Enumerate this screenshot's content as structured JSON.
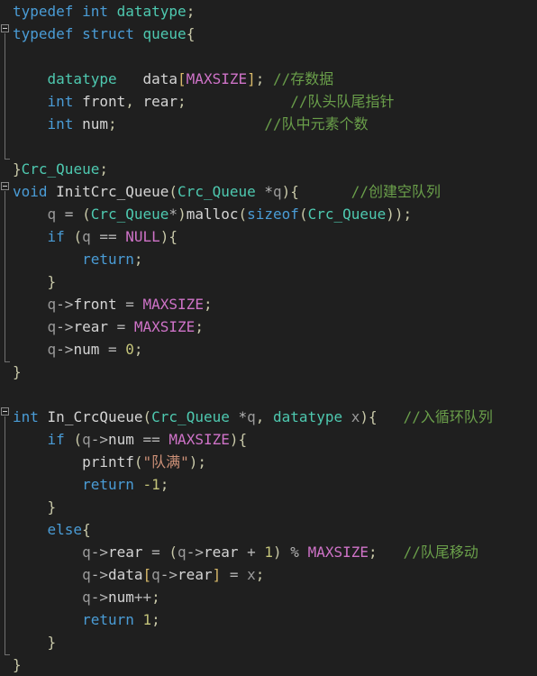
{
  "editor": {
    "name": "code-editor",
    "language": "C",
    "theme": "dark",
    "background_color": "#1f1f1f",
    "colors": {
      "keyword": "#4a9cd6",
      "type": "#4ec9b0",
      "identifier": "#d4d4d4",
      "variable": "#9a9a9a",
      "macro": "#cf73c8",
      "number": "#c4c47a",
      "string": "#ce9178",
      "comment": "#6a9f4a",
      "punctuation": "#c8c8a8",
      "bracket": "#d8b96a"
    },
    "fold_markers": [
      {
        "name": "fold-marker-struct-queue",
        "line": 2,
        "state": "expanded"
      },
      {
        "name": "fold-marker-init-crc-queue",
        "line": 8,
        "state": "expanded"
      },
      {
        "name": "fold-marker-in-crcqueue",
        "line": 18,
        "state": "expanded"
      }
    ]
  },
  "code_lines": [
    {
      "id": 1,
      "tokens": [
        {
          "t": "typedef",
          "c": "kw"
        },
        {
          "t": " ",
          "c": "pun"
        },
        {
          "t": "int",
          "c": "kw"
        },
        {
          "t": " ",
          "c": "pun"
        },
        {
          "t": "datatype",
          "c": "typ"
        },
        {
          "t": ";",
          "c": "pun"
        }
      ]
    },
    {
      "id": 2,
      "tokens": [
        {
          "t": "typedef",
          "c": "kw"
        },
        {
          "t": " ",
          "c": "pun"
        },
        {
          "t": "struct",
          "c": "kw"
        },
        {
          "t": " ",
          "c": "pun"
        },
        {
          "t": "queue",
          "c": "typ"
        },
        {
          "t": "{",
          "c": "pun"
        }
      ]
    },
    {
      "id": 3,
      "tokens": []
    },
    {
      "id": 4,
      "tokens": [
        {
          "t": "    ",
          "c": "pun"
        },
        {
          "t": "datatype",
          "c": "typ"
        },
        {
          "t": "   ",
          "c": "pun"
        },
        {
          "t": "data",
          "c": "fn"
        },
        {
          "t": "[",
          "c": "brk"
        },
        {
          "t": "MAXSIZE",
          "c": "mac"
        },
        {
          "t": "]",
          "c": "brk"
        },
        {
          "t": ";",
          "c": "pun"
        },
        {
          "t": " ",
          "c": "pun"
        },
        {
          "t": "//存数据",
          "c": "cmt"
        }
      ]
    },
    {
      "id": 5,
      "tokens": [
        {
          "t": "    ",
          "c": "pun"
        },
        {
          "t": "int",
          "c": "kw"
        },
        {
          "t": " ",
          "c": "pun"
        },
        {
          "t": "front",
          "c": "fn"
        },
        {
          "t": ", ",
          "c": "pun"
        },
        {
          "t": "rear",
          "c": "fn"
        },
        {
          "t": ";",
          "c": "pun"
        },
        {
          "t": "            ",
          "c": "pun"
        },
        {
          "t": "//队头队尾指针",
          "c": "cmt"
        }
      ]
    },
    {
      "id": 6,
      "tokens": [
        {
          "t": "    ",
          "c": "pun"
        },
        {
          "t": "int",
          "c": "kw"
        },
        {
          "t": " ",
          "c": "pun"
        },
        {
          "t": "num",
          "c": "fn"
        },
        {
          "t": ";",
          "c": "pun"
        },
        {
          "t": "                 ",
          "c": "pun"
        },
        {
          "t": "//队中元素个数",
          "c": "cmt"
        }
      ]
    },
    {
      "id": 7,
      "tokens": []
    },
    {
      "id": 8,
      "tokens": [
        {
          "t": "}",
          "c": "pun"
        },
        {
          "t": "Crc_Queue",
          "c": "typ"
        },
        {
          "t": ";",
          "c": "pun"
        }
      ]
    },
    {
      "id": 9,
      "tokens": [
        {
          "t": "void",
          "c": "kw"
        },
        {
          "t": " ",
          "c": "pun"
        },
        {
          "t": "InitCrc_Queue",
          "c": "fn"
        },
        {
          "t": "(",
          "c": "pun"
        },
        {
          "t": "Crc_Queue",
          "c": "typ"
        },
        {
          "t": " *",
          "c": "op"
        },
        {
          "t": "q",
          "c": "var"
        },
        {
          "t": ")",
          "c": "pun"
        },
        {
          "t": "{",
          "c": "pun"
        },
        {
          "t": "      ",
          "c": "pun"
        },
        {
          "t": "//创建空队列",
          "c": "cmt"
        }
      ]
    },
    {
      "id": 10,
      "tokens": [
        {
          "t": "    ",
          "c": "pun"
        },
        {
          "t": "q",
          "c": "var"
        },
        {
          "t": " = ",
          "c": "op"
        },
        {
          "t": "(",
          "c": "pun"
        },
        {
          "t": "Crc_Queue",
          "c": "typ"
        },
        {
          "t": "*",
          "c": "op"
        },
        {
          "t": ")",
          "c": "pun"
        },
        {
          "t": "malloc",
          "c": "fn"
        },
        {
          "t": "(",
          "c": "pun"
        },
        {
          "t": "sizeof",
          "c": "kw"
        },
        {
          "t": "(",
          "c": "pun"
        },
        {
          "t": "Crc_Queue",
          "c": "typ"
        },
        {
          "t": "))",
          "c": "pun"
        },
        {
          "t": ";",
          "c": "pun"
        }
      ]
    },
    {
      "id": 11,
      "tokens": [
        {
          "t": "    ",
          "c": "pun"
        },
        {
          "t": "if",
          "c": "kw"
        },
        {
          "t": " ",
          "c": "pun"
        },
        {
          "t": "(",
          "c": "pun"
        },
        {
          "t": "q",
          "c": "var"
        },
        {
          "t": " == ",
          "c": "op"
        },
        {
          "t": "NULL",
          "c": "mac"
        },
        {
          "t": ")",
          "c": "pun"
        },
        {
          "t": "{",
          "c": "pun"
        }
      ]
    },
    {
      "id": 12,
      "tokens": [
        {
          "t": "        ",
          "c": "pun"
        },
        {
          "t": "return",
          "c": "kw"
        },
        {
          "t": ";",
          "c": "pun"
        }
      ]
    },
    {
      "id": 13,
      "tokens": [
        {
          "t": "    ",
          "c": "pun"
        },
        {
          "t": "}",
          "c": "pun"
        }
      ]
    },
    {
      "id": 14,
      "tokens": [
        {
          "t": "    ",
          "c": "pun"
        },
        {
          "t": "q",
          "c": "var"
        },
        {
          "t": "->",
          "c": "op"
        },
        {
          "t": "front",
          "c": "fn"
        },
        {
          "t": " = ",
          "c": "op"
        },
        {
          "t": "MAXSIZE",
          "c": "mac"
        },
        {
          "t": ";",
          "c": "pun"
        }
      ]
    },
    {
      "id": 15,
      "tokens": [
        {
          "t": "    ",
          "c": "pun"
        },
        {
          "t": "q",
          "c": "var"
        },
        {
          "t": "->",
          "c": "op"
        },
        {
          "t": "rear",
          "c": "fn"
        },
        {
          "t": " = ",
          "c": "op"
        },
        {
          "t": "MAXSIZE",
          "c": "mac"
        },
        {
          "t": ";",
          "c": "pun"
        }
      ]
    },
    {
      "id": 16,
      "tokens": [
        {
          "t": "    ",
          "c": "pun"
        },
        {
          "t": "q",
          "c": "var"
        },
        {
          "t": "->",
          "c": "op"
        },
        {
          "t": "num",
          "c": "fn"
        },
        {
          "t": " = ",
          "c": "op"
        },
        {
          "t": "0",
          "c": "num"
        },
        {
          "t": ";",
          "c": "pun"
        }
      ]
    },
    {
      "id": 17,
      "tokens": [
        {
          "t": "}",
          "c": "pun"
        }
      ]
    },
    {
      "id": 18,
      "tokens": []
    },
    {
      "id": 19,
      "tokens": [
        {
          "t": "int",
          "c": "kw"
        },
        {
          "t": " ",
          "c": "pun"
        },
        {
          "t": "In_CrcQueue",
          "c": "fn"
        },
        {
          "t": "(",
          "c": "pun"
        },
        {
          "t": "Crc_Queue",
          "c": "typ"
        },
        {
          "t": " *",
          "c": "op"
        },
        {
          "t": "q",
          "c": "var"
        },
        {
          "t": ", ",
          "c": "pun"
        },
        {
          "t": "datatype",
          "c": "typ"
        },
        {
          "t": " ",
          "c": "pun"
        },
        {
          "t": "x",
          "c": "var"
        },
        {
          "t": ")",
          "c": "pun"
        },
        {
          "t": "{",
          "c": "pun"
        },
        {
          "t": "   ",
          "c": "pun"
        },
        {
          "t": "//入循环队列",
          "c": "cmt"
        }
      ]
    },
    {
      "id": 20,
      "tokens": [
        {
          "t": "    ",
          "c": "pun"
        },
        {
          "t": "if",
          "c": "kw"
        },
        {
          "t": " ",
          "c": "pun"
        },
        {
          "t": "(",
          "c": "pun"
        },
        {
          "t": "q",
          "c": "var"
        },
        {
          "t": "->",
          "c": "op"
        },
        {
          "t": "num",
          "c": "fn"
        },
        {
          "t": " == ",
          "c": "op"
        },
        {
          "t": "MAXSIZE",
          "c": "mac"
        },
        {
          "t": ")",
          "c": "pun"
        },
        {
          "t": "{",
          "c": "pun"
        }
      ]
    },
    {
      "id": 21,
      "tokens": [
        {
          "t": "        ",
          "c": "pun"
        },
        {
          "t": "printf",
          "c": "fn"
        },
        {
          "t": "(",
          "c": "pun"
        },
        {
          "t": "\"队满\"",
          "c": "str"
        },
        {
          "t": ")",
          "c": "pun"
        },
        {
          "t": ";",
          "c": "pun"
        }
      ]
    },
    {
      "id": 22,
      "tokens": [
        {
          "t": "        ",
          "c": "pun"
        },
        {
          "t": "return",
          "c": "kw"
        },
        {
          "t": " ",
          "c": "pun"
        },
        {
          "t": "-1",
          "c": "num"
        },
        {
          "t": ";",
          "c": "pun"
        }
      ]
    },
    {
      "id": 23,
      "tokens": [
        {
          "t": "    ",
          "c": "pun"
        },
        {
          "t": "}",
          "c": "pun"
        }
      ]
    },
    {
      "id": 24,
      "tokens": [
        {
          "t": "    ",
          "c": "pun"
        },
        {
          "t": "else",
          "c": "kw"
        },
        {
          "t": "{",
          "c": "pun"
        }
      ]
    },
    {
      "id": 25,
      "tokens": [
        {
          "t": "        ",
          "c": "pun"
        },
        {
          "t": "q",
          "c": "var"
        },
        {
          "t": "->",
          "c": "op"
        },
        {
          "t": "rear",
          "c": "fn"
        },
        {
          "t": " = ",
          "c": "op"
        },
        {
          "t": "(",
          "c": "pun"
        },
        {
          "t": "q",
          "c": "var"
        },
        {
          "t": "->",
          "c": "op"
        },
        {
          "t": "rear",
          "c": "fn"
        },
        {
          "t": " + ",
          "c": "op"
        },
        {
          "t": "1",
          "c": "num"
        },
        {
          "t": ")",
          "c": "pun"
        },
        {
          "t": " % ",
          "c": "op"
        },
        {
          "t": "MAXSIZE",
          "c": "mac"
        },
        {
          "t": ";",
          "c": "pun"
        },
        {
          "t": "   ",
          "c": "pun"
        },
        {
          "t": "//队尾移动",
          "c": "cmt"
        }
      ]
    },
    {
      "id": 26,
      "tokens": [
        {
          "t": "        ",
          "c": "pun"
        },
        {
          "t": "q",
          "c": "var"
        },
        {
          "t": "->",
          "c": "op"
        },
        {
          "t": "data",
          "c": "fn"
        },
        {
          "t": "[",
          "c": "brk"
        },
        {
          "t": "q",
          "c": "var"
        },
        {
          "t": "->",
          "c": "op"
        },
        {
          "t": "rear",
          "c": "fn"
        },
        {
          "t": "]",
          "c": "brk"
        },
        {
          "t": " = ",
          "c": "op"
        },
        {
          "t": "x",
          "c": "var"
        },
        {
          "t": ";",
          "c": "pun"
        }
      ]
    },
    {
      "id": 27,
      "tokens": [
        {
          "t": "        ",
          "c": "pun"
        },
        {
          "t": "q",
          "c": "var"
        },
        {
          "t": "->",
          "c": "op"
        },
        {
          "t": "num",
          "c": "fn"
        },
        {
          "t": "++",
          "c": "op"
        },
        {
          "t": ";",
          "c": "pun"
        }
      ]
    },
    {
      "id": 28,
      "tokens": [
        {
          "t": "        ",
          "c": "pun"
        },
        {
          "t": "return",
          "c": "kw"
        },
        {
          "t": " ",
          "c": "pun"
        },
        {
          "t": "1",
          "c": "num"
        },
        {
          "t": ";",
          "c": "pun"
        }
      ]
    },
    {
      "id": 29,
      "tokens": [
        {
          "t": "    ",
          "c": "pun"
        },
        {
          "t": "}",
          "c": "pun"
        }
      ]
    },
    {
      "id": 30,
      "tokens": [
        {
          "t": "}",
          "c": "pun"
        }
      ]
    }
  ]
}
